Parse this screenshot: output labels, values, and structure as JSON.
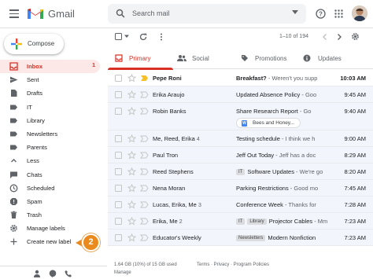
{
  "app": {
    "name": "Gmail",
    "accent_red": "#d93025",
    "callout_color": "#ea8a1d"
  },
  "header": {
    "search_placeholder": "Search mail"
  },
  "compose_label": "Compose",
  "nav": [
    {
      "label": "Inbox",
      "count": "1",
      "icon": "inbox-icon",
      "active": true
    },
    {
      "label": "Sent",
      "icon": "send-icon"
    },
    {
      "label": "Drafts",
      "icon": "draft-icon"
    },
    {
      "label": "IT",
      "icon": "label-icon"
    },
    {
      "label": "Library",
      "icon": "label-icon"
    },
    {
      "label": "Newsletters",
      "icon": "label-icon"
    },
    {
      "label": "Parents",
      "icon": "label-icon"
    },
    {
      "label": "Less",
      "icon": "chevron-up-icon"
    },
    {
      "label": "Chats",
      "icon": "chat-icon"
    },
    {
      "label": "Scheduled",
      "icon": "clock-icon"
    },
    {
      "label": "Spam",
      "icon": "spam-icon"
    },
    {
      "label": "Trash",
      "icon": "trash-icon"
    },
    {
      "label": "Manage labels",
      "icon": "gear-icon"
    },
    {
      "label": "Create new label",
      "icon": "plus-icon"
    }
  ],
  "callout": {
    "number": "2"
  },
  "toolbar": {
    "pager": "1–10 of 194"
  },
  "tabs": [
    {
      "label": "Primary",
      "icon": "inbox-icon",
      "active": true
    },
    {
      "label": "Social",
      "icon": "people-icon"
    },
    {
      "label": "Promotions",
      "icon": "tag-icon"
    },
    {
      "label": "Updates",
      "icon": "info-icon"
    }
  ],
  "emails": [
    {
      "sender": "Pepe Roni",
      "count": "",
      "tags": [],
      "subject": "Breakfast?",
      "snippet": " - Weren't you supp",
      "time": "10:03 AM",
      "unread": true,
      "important": true
    },
    {
      "sender": "Erika Araujo",
      "count": "",
      "tags": [],
      "subject": "Updated Absence Policy",
      "snippet": " - Goo",
      "time": "9:45 AM",
      "unread": false,
      "important": false
    },
    {
      "sender": "Robin Banks",
      "count": "",
      "tags": [],
      "subject": "Share Research Report",
      "snippet": " - Go",
      "time": "9:40 AM",
      "unread": false,
      "important": false,
      "attachment": "Bees and Honey..."
    },
    {
      "sender": "Me, Reed, Erika",
      "count": "4",
      "tags": [],
      "subject": "Testing schedule",
      "snippet": " - I think we h",
      "time": "9:00 AM",
      "unread": false,
      "important": false
    },
    {
      "sender": "Paul Tron",
      "count": "",
      "tags": [],
      "subject": "Jeff Out Today",
      "snippet": " - Jeff has a doc",
      "time": "8:29 AM",
      "unread": false,
      "important": false
    },
    {
      "sender": "Reed Stephens",
      "count": "",
      "tags": [
        "IT"
      ],
      "subject": "Software Updates",
      "snippet": " - We're go",
      "time": "8:20 AM",
      "unread": false,
      "important": false
    },
    {
      "sender": "Nena Moran",
      "count": "",
      "tags": [],
      "subject": "Parking Restrictions",
      "snippet": " - Good mo",
      "time": "7:45 AM",
      "unread": false,
      "important": false
    },
    {
      "sender": "Lucas, Erika, Me",
      "count": "3",
      "tags": [],
      "subject": "Conference Week",
      "snippet": " - Thanks for",
      "time": "7:28 AM",
      "unread": false,
      "important": false
    },
    {
      "sender": "Erika, Me",
      "count": "2",
      "tags": [
        "IT",
        "Library"
      ],
      "subject": "Projector Cables",
      "snippet": " - Mm",
      "time": "7:23 AM",
      "unread": false,
      "important": false
    },
    {
      "sender": "Educator's Weekly",
      "count": "",
      "tags": [
        "Newsletters"
      ],
      "subject": "Modern Nonfiction",
      "snippet": "",
      "time": "7:23 AM",
      "unread": false,
      "important": false
    }
  ],
  "footer": {
    "storage": "1.64 GB (10%) of 15 GB used",
    "manage": "Manage",
    "links": "Terms · Privacy · Program Policies"
  }
}
